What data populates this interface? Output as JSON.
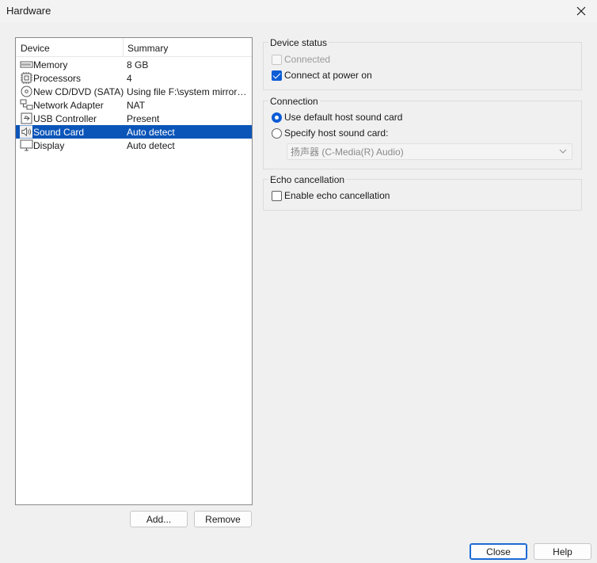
{
  "window": {
    "title": "Hardware"
  },
  "devices": {
    "headers": {
      "device": "Device",
      "summary": "Summary"
    },
    "items": [
      {
        "icon": "memory-icon",
        "name": "Memory",
        "summary": "8 GB"
      },
      {
        "icon": "processor-icon",
        "name": "Processors",
        "summary": "4"
      },
      {
        "icon": "cd-dvd-icon",
        "name": "New CD/DVD (SATA)",
        "summary": "Using file F:\\system mirrors\\li..."
      },
      {
        "icon": "network-adapter-icon",
        "name": "Network Adapter",
        "summary": "NAT"
      },
      {
        "icon": "usb-icon",
        "name": "USB Controller",
        "summary": "Present"
      },
      {
        "icon": "sound-card-icon",
        "name": "Sound Card",
        "summary": "Auto detect",
        "selected": true
      },
      {
        "icon": "display-icon",
        "name": "Display",
        "summary": "Auto detect"
      }
    ],
    "add_label": "Add...",
    "remove_label": "Remove"
  },
  "device_status": {
    "title": "Device status",
    "connected": {
      "label": "Connected",
      "checked": false,
      "disabled": true
    },
    "connect_power": {
      "label": "Connect at power on",
      "checked": true
    }
  },
  "connection": {
    "title": "Connection",
    "default_host": {
      "label": "Use default host sound card",
      "selected": true
    },
    "specify_host": {
      "label": "Specify host sound card:",
      "selected": false
    },
    "sound_card_select": {
      "value": "扬声器 (C-Media(R) Audio)",
      "disabled": true
    }
  },
  "echo": {
    "title": "Echo cancellation",
    "enable": {
      "label": "Enable echo cancellation",
      "checked": false
    }
  },
  "footer": {
    "close_label": "Close",
    "help_label": "Help"
  },
  "colors": {
    "accent": "#0b5cd5",
    "selection": "#0b55b9"
  }
}
